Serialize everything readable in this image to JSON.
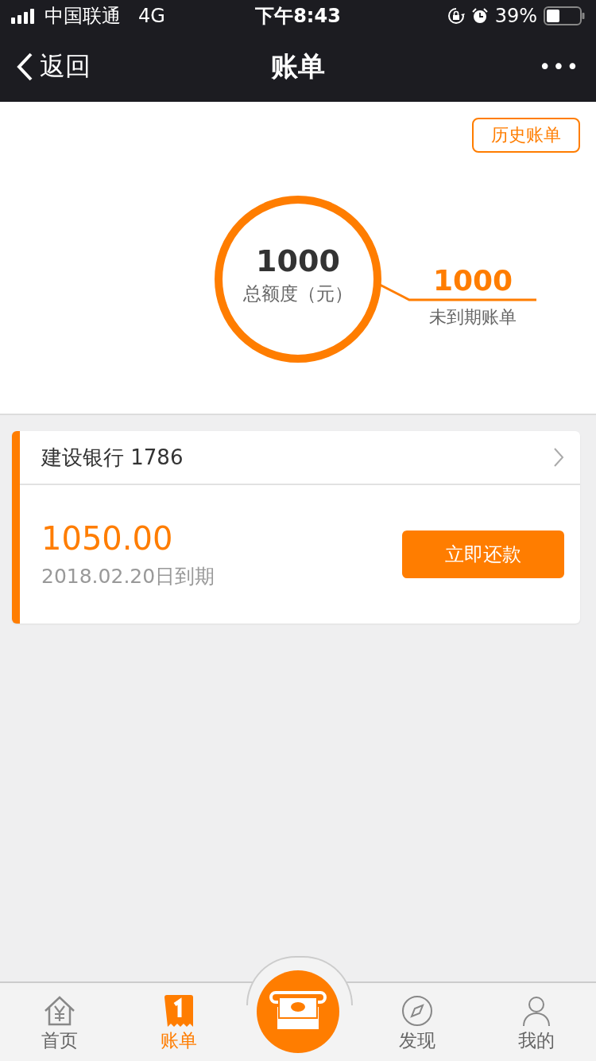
{
  "status_bar": {
    "carrier": "中国联通",
    "network": "4G",
    "time": "下午8:43",
    "battery": "39%"
  },
  "nav": {
    "back": "返回",
    "title": "账单",
    "more": "•••"
  },
  "history_button": "历史账单",
  "summary": {
    "total": "1000",
    "total_label": "总额度（元）",
    "pending": "1000",
    "pending_label": "未到期账单"
  },
  "bill": {
    "bank": "建设银行 1786",
    "amount": "1050.00",
    "due": "2018.02.20日到期",
    "pay_button": "立即还款"
  },
  "tabs": [
    {
      "kind": "home",
      "label": "首页",
      "selected": false
    },
    {
      "kind": "bill",
      "label": "账单",
      "selected": true
    },
    {
      "kind": "center",
      "selected": false
    },
    {
      "kind": "discover",
      "label": "发现",
      "selected": false
    },
    {
      "kind": "profile",
      "label": "我的",
      "selected": false
    }
  ]
}
